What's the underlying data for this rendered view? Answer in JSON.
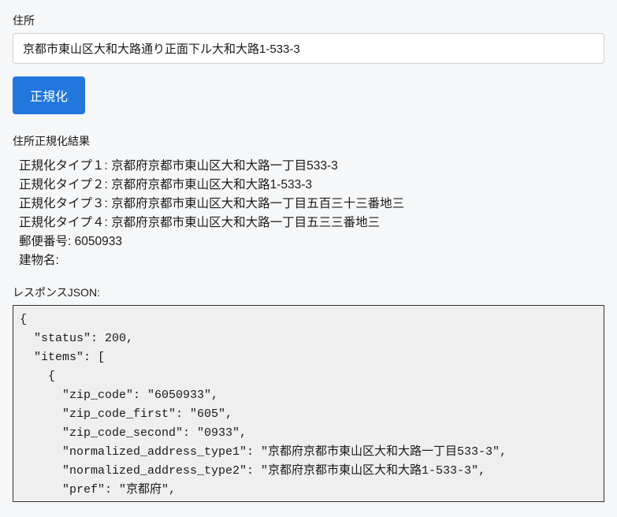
{
  "form": {
    "address_label": "住所",
    "address_value": "京都市東山区大和大路通り正面下ル大和大路1-533-3",
    "submit_label": "正規化"
  },
  "results": {
    "heading": "住所正規化結果",
    "lines": [
      "正規化タイプ１: 京都府京都市東山区大和大路一丁目533-3",
      "正規化タイプ２: 京都府京都市東山区大和大路1-533-3",
      "正規化タイプ３: 京都府京都市東山区大和大路一丁目五百三十三番地三",
      "正規化タイプ４: 京都府京都市東山区大和大路一丁目五三三番地三",
      "郵便番号: 6050933",
      "建物名:"
    ]
  },
  "response": {
    "label": "レスポンスJSON:",
    "body": "{\n  \"status\": 200,\n  \"items\": [\n    {\n      \"zip_code\": \"6050933\",\n      \"zip_code_first\": \"605\",\n      \"zip_code_second\": \"0933\",\n      \"normalized_address_type1\": \"京都府京都市東山区大和大路一丁目533-3\",\n      \"normalized_address_type2\": \"京都府京都市東山区大和大路1-533-3\",\n      \"pref\": \"京都府\","
  }
}
